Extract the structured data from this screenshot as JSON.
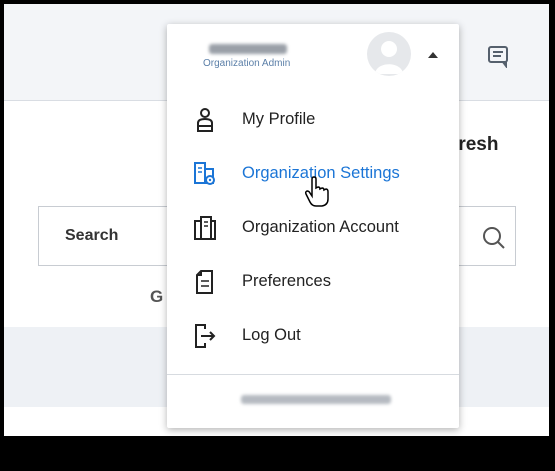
{
  "page": {
    "refresh_text": "fresh",
    "search": {
      "label": "Search"
    },
    "partial_letter": "G"
  },
  "user_menu": {
    "role": "Organization Admin",
    "items": [
      {
        "label": "My Profile",
        "icon": "person-icon"
      },
      {
        "label": "Organization Settings",
        "icon": "organization-settings-icon",
        "active": true
      },
      {
        "label": "Organization Account",
        "icon": "organization-account-icon"
      },
      {
        "label": "Preferences",
        "icon": "preferences-icon"
      },
      {
        "label": "Log Out",
        "icon": "logout-icon"
      }
    ]
  },
  "colors": {
    "accent": "#1b75d6",
    "role_text": "#5b7fa8",
    "topbar": "#f3f5f8"
  }
}
